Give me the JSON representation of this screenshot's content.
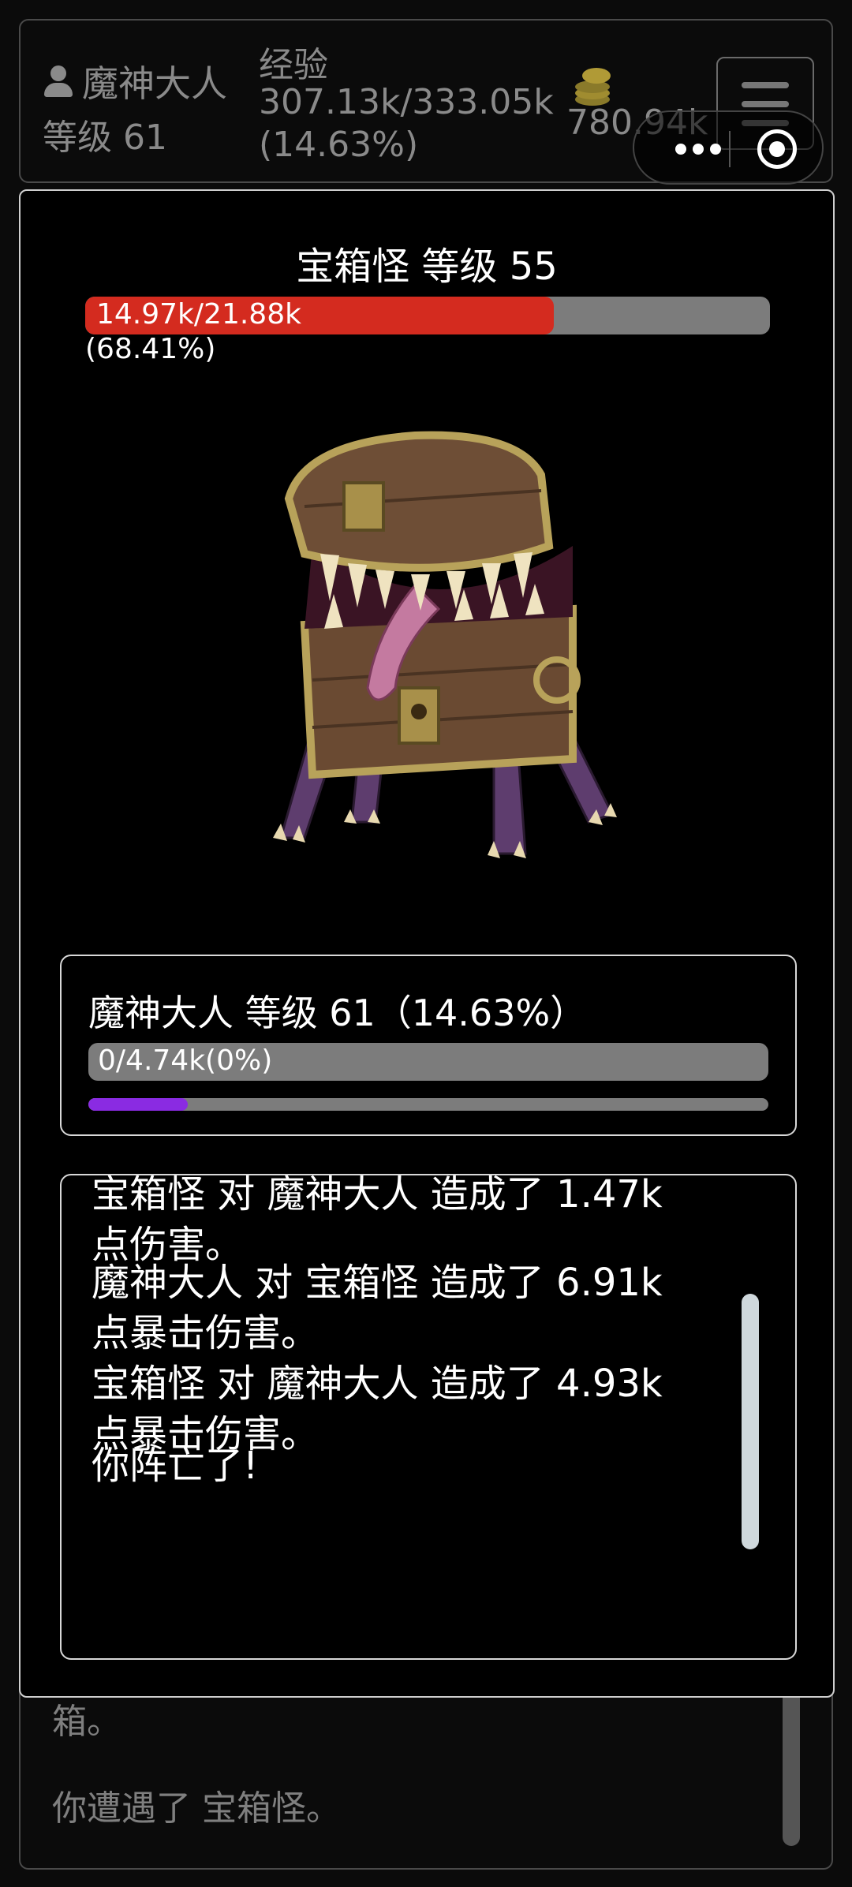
{
  "header": {
    "player_name": "魔神大人",
    "level_label": "等级 61",
    "exp_label": "经验",
    "exp_value": "307.13k/333.05k",
    "exp_percent": "(14.63%)",
    "gold": "780.94k"
  },
  "enemy": {
    "title": "宝箱怪 等级 55",
    "hp_text": "14.97k/21.88k",
    "hp_percent_text": "(68.41%)",
    "hp_fraction": 0.6841,
    "image": "mimic-chest-monster"
  },
  "player_panel": {
    "title": "魔神大人 等级 61（14.63%）",
    "shield_text": "0/4.74k(0%)",
    "shield_fraction": 0,
    "xp_fraction": 0.1463
  },
  "battle_log": [
    "宝箱怪 对 魔神大人 造成了 1.47k 点伤害。",
    "魔神大人 对 宝箱怪 造成了 6.91k 点暴击伤害。",
    "宝箱怪 对 魔神大人 造成了 4.93k 点暴击伤害。",
    "你阵亡了!"
  ],
  "background_log": [
    "箱。",
    "你遭遇了 宝箱怪。"
  ],
  "colors": {
    "hp_bar": "#d42b1f",
    "xp_bar": "#8a2be2",
    "bar_track": "#7c7c7c"
  }
}
